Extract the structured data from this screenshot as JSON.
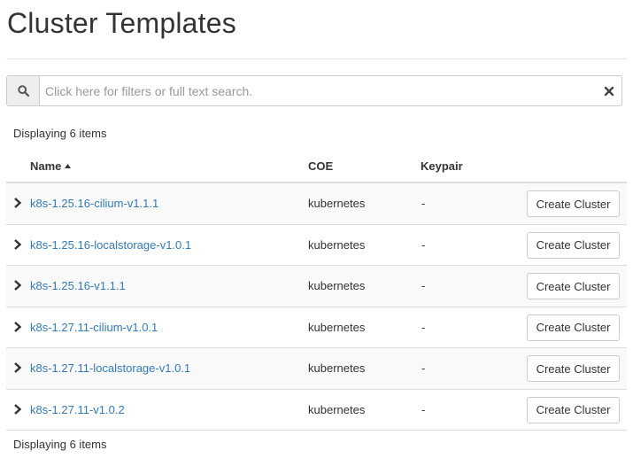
{
  "page": {
    "title": "Cluster Templates"
  },
  "search": {
    "placeholder": "Click here for filters or full text search.",
    "value": ""
  },
  "table": {
    "count_top": "Displaying 6 items",
    "count_bottom": "Displaying 6 items",
    "columns": {
      "name": "Name",
      "coe": "COE",
      "keypair": "Keypair"
    },
    "sort": {
      "column": "Name",
      "direction": "ascending",
      "icon": "sort-ascending-icon"
    },
    "rows": [
      {
        "name": "k8s-1.25.16-cilium-v1.1.1",
        "coe": "kubernetes",
        "keypair": "-",
        "action": "Create Cluster"
      },
      {
        "name": "k8s-1.25.16-localstorage-v1.0.1",
        "coe": "kubernetes",
        "keypair": "-",
        "action": "Create Cluster"
      },
      {
        "name": "k8s-1.25.16-v1.1.1",
        "coe": "kubernetes",
        "keypair": "-",
        "action": "Create Cluster"
      },
      {
        "name": "k8s-1.27.11-cilium-v1.0.1",
        "coe": "kubernetes",
        "keypair": "-",
        "action": "Create Cluster"
      },
      {
        "name": "k8s-1.27.11-localstorage-v1.0.1",
        "coe": "kubernetes",
        "keypair": "-",
        "action": "Create Cluster"
      },
      {
        "name": "k8s-1.27.11-v1.0.2",
        "coe": "kubernetes",
        "keypair": "-",
        "action": "Create Cluster"
      }
    ]
  },
  "icons": {
    "search": "search-icon",
    "clear": "close-icon",
    "expand": "chevron-right-icon"
  },
  "colors": {
    "link": "#337ab7",
    "text": "#333333",
    "stripe": "#f9f9f9",
    "border": "#dddddd"
  }
}
